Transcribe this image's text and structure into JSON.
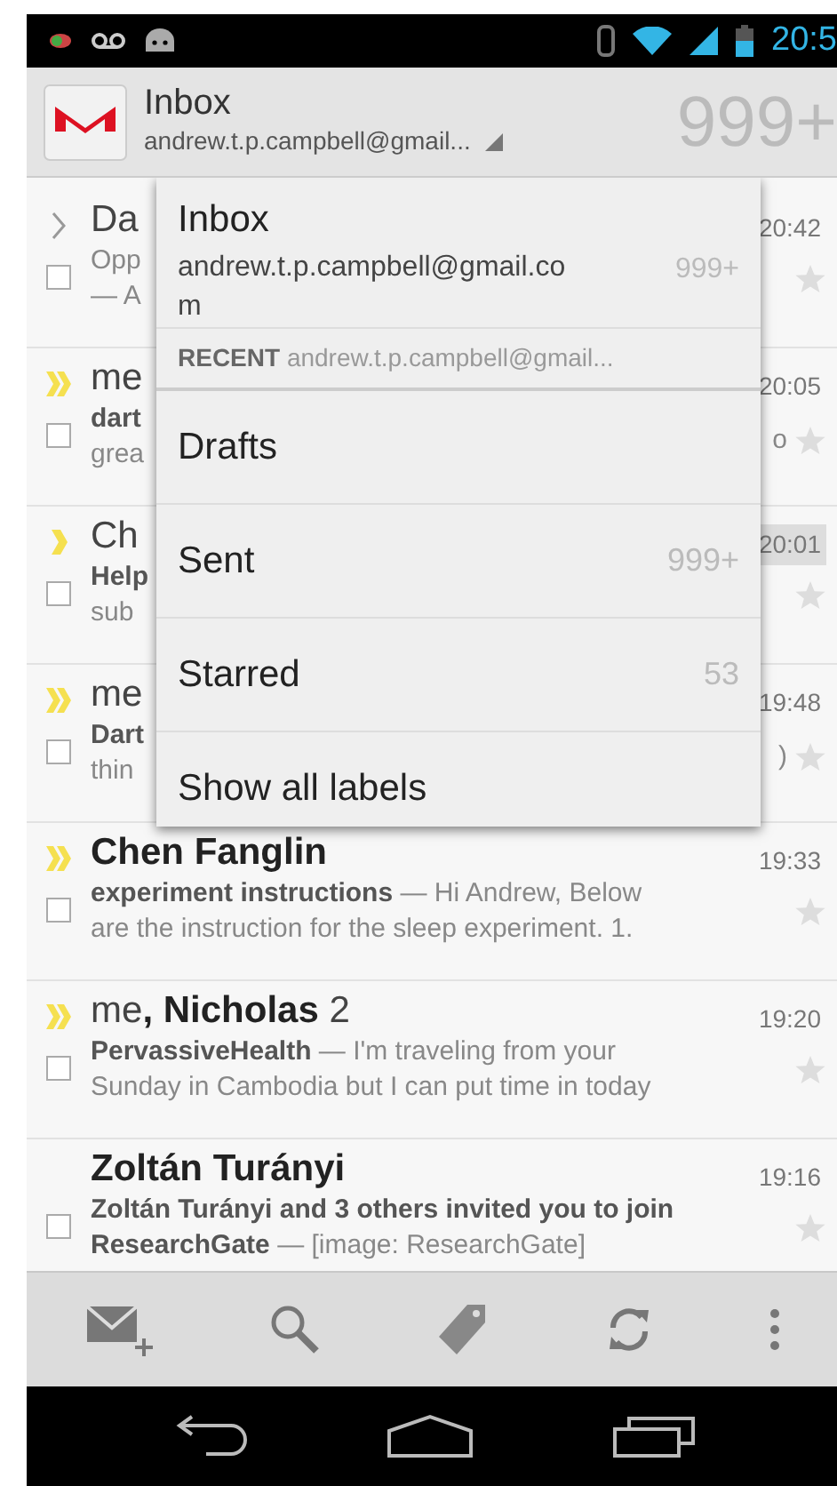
{
  "status_bar": {
    "time": "20:5"
  },
  "action_bar": {
    "title": "Inbox",
    "account": "andrew.t.p.campbell@gmail...",
    "count": "999+"
  },
  "messages": [
    {
      "kind": "gray_single",
      "sender": "Da",
      "lines": [
        "Opp",
        "— A"
      ],
      "time": "20:42",
      "unread": false,
      "checked": false,
      "starred": false,
      "time_highlight": false
    },
    {
      "kind": "yellow_double",
      "sender": "me",
      "lines": [
        "**dart**",
        "grea"
      ],
      "time": "20:05",
      "tail": "o",
      "unread": false,
      "checked": false,
      "starred": false,
      "time_highlight": false
    },
    {
      "kind": "yellow_single",
      "sender": "Ch",
      "lines": [
        "**Help**",
        "sub"
      ],
      "time": "20:01",
      "unread": false,
      "checked": false,
      "starred": false,
      "time_highlight": true
    },
    {
      "kind": "yellow_double",
      "sender": "me",
      "lines": [
        "**Dart**",
        "thin"
      ],
      "time": "19:48",
      "tail": ")",
      "unread": false,
      "checked": false,
      "starred": false,
      "time_highlight": false
    },
    {
      "kind": "yellow_double",
      "sender": "Chen Fanglin",
      "lines": [
        "**experiment instructions** — Hi Andrew, Below",
        "are the instruction for the sleep experiment. 1."
      ],
      "time": "19:33",
      "unread": true,
      "checked": false,
      "starred": false,
      "time_highlight": false
    },
    {
      "kind": "yellow_double",
      "sender": "me**, Nicholas** 2",
      "lines": [
        "**PervassiveHealth** — I'm traveling from your",
        "Sunday in Cambodia but I can put time in today"
      ],
      "time": "19:20",
      "unread": false,
      "checked": false,
      "starred": false,
      "time_highlight": false
    },
    {
      "kind": "plain",
      "sender": "Zoltán Turányi",
      "lines": [
        "**Zoltán Turányi and 3 others invited you to join**",
        "**ResearchGate** — [image: ResearchGate]"
      ],
      "time": "19:16",
      "unread": true,
      "checked": false,
      "starred": false,
      "time_highlight": false
    }
  ],
  "dropdown": {
    "account": {
      "title": "Inbox",
      "email": "andrew.t.p.campbell@gmail.com",
      "count": "999+"
    },
    "recent": {
      "label": "RECENT",
      "email": "andrew.t.p.campbell@gmail..."
    },
    "items": [
      {
        "label": "Drafts"
      },
      {
        "label": "Sent",
        "count": "999+"
      },
      {
        "label": "Starred",
        "count": "53"
      },
      {
        "label": "Show all labels"
      }
    ]
  }
}
